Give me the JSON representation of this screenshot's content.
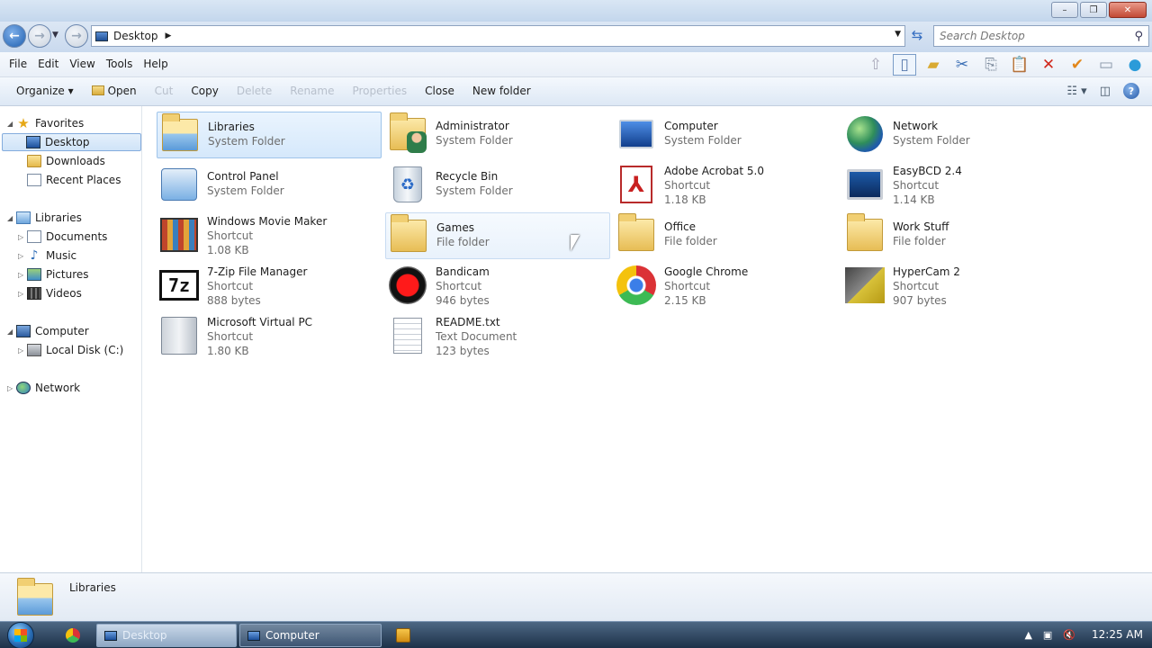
{
  "window": {
    "title": "",
    "buttons": {
      "minimize": "–",
      "maximize": "❐",
      "close": "✕"
    }
  },
  "address": {
    "location": "Desktop",
    "search_placeholder": "Search Desktop"
  },
  "menu": [
    "File",
    "Edit",
    "View",
    "Tools",
    "Help"
  ],
  "commands": {
    "organize": "Organize ▾",
    "open": "Open",
    "cut": "Cut",
    "copy": "Copy",
    "delete": "Delete",
    "rename": "Rename",
    "properties": "Properties",
    "close": "Close",
    "new_folder": "New folder"
  },
  "nav": {
    "favorites": "Favorites",
    "desktop": "Desktop",
    "downloads": "Downloads",
    "recent_places": "Recent Places",
    "libraries": "Libraries",
    "documents": "Documents",
    "music": "Music",
    "pictures": "Pictures",
    "videos": "Videos",
    "computer": "Computer",
    "local_disk": "Local Disk (C:)",
    "network": "Network"
  },
  "items": [
    {
      "name": "Libraries",
      "type": "System Folder",
      "size": ""
    },
    {
      "name": "Administrator",
      "type": "System Folder",
      "size": ""
    },
    {
      "name": "Computer",
      "type": "System Folder",
      "size": ""
    },
    {
      "name": "Network",
      "type": "System Folder",
      "size": ""
    },
    {
      "name": "Control Panel",
      "type": "System Folder",
      "size": ""
    },
    {
      "name": "Recycle Bin",
      "type": "System Folder",
      "size": ""
    },
    {
      "name": "Adobe Acrobat 5.0",
      "type": "Shortcut",
      "size": "1.18 KB"
    },
    {
      "name": "EasyBCD 2.4",
      "type": "Shortcut",
      "size": "1.14 KB"
    },
    {
      "name": "Windows Movie Maker",
      "type": "Shortcut",
      "size": "1.08 KB"
    },
    {
      "name": "Games",
      "type": "File folder",
      "size": ""
    },
    {
      "name": "Office",
      "type": "File folder",
      "size": ""
    },
    {
      "name": "Work Stuff",
      "type": "File folder",
      "size": ""
    },
    {
      "name": "7-Zip File Manager",
      "type": "Shortcut",
      "size": "888 bytes"
    },
    {
      "name": "Bandicam",
      "type": "Shortcut",
      "size": "946 bytes"
    },
    {
      "name": "Google Chrome",
      "type": "Shortcut",
      "size": "2.15 KB"
    },
    {
      "name": "HyperCam 2",
      "type": "Shortcut",
      "size": "907 bytes"
    },
    {
      "name": "Microsoft Virtual PC",
      "type": "Shortcut",
      "size": "1.80 KB"
    },
    {
      "name": "README.txt",
      "type": "Text Document",
      "size": "123 bytes"
    }
  ],
  "details": {
    "selected_name": "Libraries"
  },
  "taskbar": {
    "task1": "Desktop",
    "task2": "Computer",
    "clock": "12:25 AM"
  },
  "icons": {
    "seven_zip_glyph": "7z",
    "recycle_glyph": "♻",
    "acrobat_glyph": "⅄"
  }
}
